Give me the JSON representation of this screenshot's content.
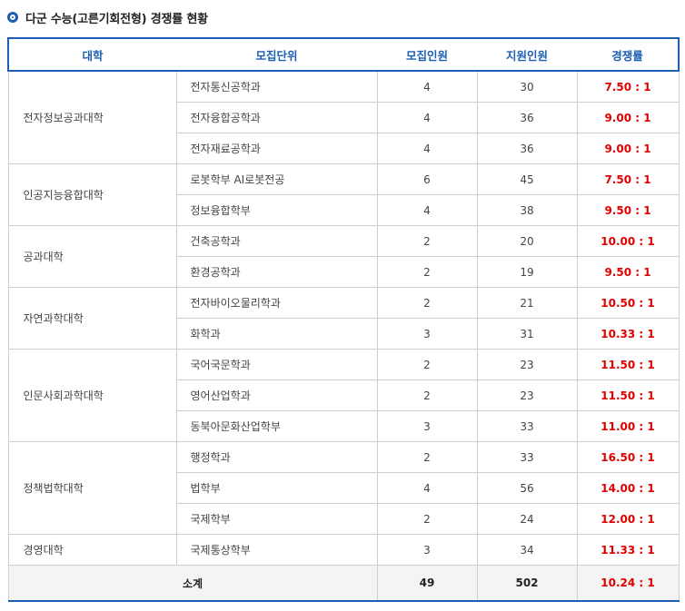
{
  "heading": "다군 수능(고른기회전형) 경쟁률 현황",
  "columns": [
    "대학",
    "모집단위",
    "모집인원",
    "지원인원",
    "경쟁률"
  ],
  "colleges": [
    {
      "name": "전자정보공과대학",
      "units": [
        {
          "unit": "전자통신공학과",
          "quota": "4",
          "applicants": "30",
          "ratio": "7.50 : 1"
        },
        {
          "unit": "전자융합공학과",
          "quota": "4",
          "applicants": "36",
          "ratio": "9.00 : 1"
        },
        {
          "unit": "전자재료공학과",
          "quota": "4",
          "applicants": "36",
          "ratio": "9.00 : 1"
        }
      ]
    },
    {
      "name": "인공지능융합대학",
      "units": [
        {
          "unit": "로봇학부 AI로봇전공",
          "quota": "6",
          "applicants": "45",
          "ratio": "7.50 : 1"
        },
        {
          "unit": "정보융합학부",
          "quota": "4",
          "applicants": "38",
          "ratio": "9.50 : 1"
        }
      ]
    },
    {
      "name": "공과대학",
      "units": [
        {
          "unit": "건축공학과",
          "quota": "2",
          "applicants": "20",
          "ratio": "10.00 : 1"
        },
        {
          "unit": "환경공학과",
          "quota": "2",
          "applicants": "19",
          "ratio": "9.50 : 1"
        }
      ]
    },
    {
      "name": "자연과학대학",
      "units": [
        {
          "unit": "전자바이오물리학과",
          "quota": "2",
          "applicants": "21",
          "ratio": "10.50 : 1"
        },
        {
          "unit": "화학과",
          "quota": "3",
          "applicants": "31",
          "ratio": "10.33 : 1"
        }
      ]
    },
    {
      "name": "인문사회과학대학",
      "units": [
        {
          "unit": "국어국문학과",
          "quota": "2",
          "applicants": "23",
          "ratio": "11.50 : 1"
        },
        {
          "unit": "영어산업학과",
          "quota": "2",
          "applicants": "23",
          "ratio": "11.50 : 1"
        },
        {
          "unit": "동북아문화산업학부",
          "quota": "3",
          "applicants": "33",
          "ratio": "11.00 : 1"
        }
      ]
    },
    {
      "name": "정책법학대학",
      "units": [
        {
          "unit": "행정학과",
          "quota": "2",
          "applicants": "33",
          "ratio": "16.50 : 1"
        },
        {
          "unit": "법학부",
          "quota": "4",
          "applicants": "56",
          "ratio": "14.00 : 1"
        },
        {
          "unit": "국제학부",
          "quota": "2",
          "applicants": "24",
          "ratio": "12.00 : 1"
        }
      ]
    },
    {
      "name": "경영대학",
      "units": [
        {
          "unit": "국제통상학부",
          "quota": "3",
          "applicants": "34",
          "ratio": "11.33 : 1"
        }
      ]
    }
  ],
  "total": {
    "label": "소계",
    "quota": "49",
    "applicants": "502",
    "ratio": "10.24 : 1"
  },
  "colors": {
    "accent": "#1a5fb4",
    "ratio": "#e00000"
  }
}
